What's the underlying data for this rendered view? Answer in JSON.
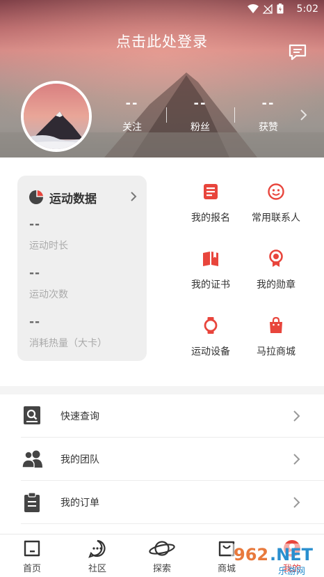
{
  "status_bar": {
    "time": "5:02"
  },
  "header": {
    "login_prompt": "点击此处登录",
    "stats": [
      {
        "value": "--",
        "label": "关注"
      },
      {
        "value": "--",
        "label": "粉丝"
      },
      {
        "value": "--",
        "label": "获赞"
      }
    ]
  },
  "sport_data": {
    "title": "运动数据",
    "metrics": [
      {
        "value": "--",
        "label": "运动时长"
      },
      {
        "value": "--",
        "label": "运动次数"
      },
      {
        "value": "--",
        "label": "消耗热量（大卡）"
      }
    ]
  },
  "grid": [
    {
      "label": "我的报名",
      "icon": "registration-icon"
    },
    {
      "label": "常用联系人",
      "icon": "contacts-icon"
    },
    {
      "label": "我的证书",
      "icon": "certificate-icon"
    },
    {
      "label": "我的勋章",
      "icon": "medal-icon"
    },
    {
      "label": "运动设备",
      "icon": "watch-icon"
    },
    {
      "label": "马拉商城",
      "icon": "shopping-bag-icon"
    }
  ],
  "list": [
    {
      "label": "快速查询",
      "icon": "search-icon"
    },
    {
      "label": "我的团队",
      "icon": "team-icon"
    },
    {
      "label": "我的订单",
      "icon": "order-icon"
    }
  ],
  "tabs": [
    {
      "label": "首页",
      "icon": "home-icon"
    },
    {
      "label": "社区",
      "icon": "chat-icon"
    },
    {
      "label": "探索",
      "icon": "planet-icon"
    },
    {
      "label": "商城",
      "icon": "shop-icon"
    },
    {
      "label": "我的",
      "icon": "profile-icon"
    }
  ],
  "watermark": {
    "text": "962.NET",
    "subtext": "乐游网"
  },
  "colors": {
    "accent": "#e8453c",
    "icon_dark": "#444444",
    "text": "#333333",
    "muted": "#aaaaaa"
  }
}
